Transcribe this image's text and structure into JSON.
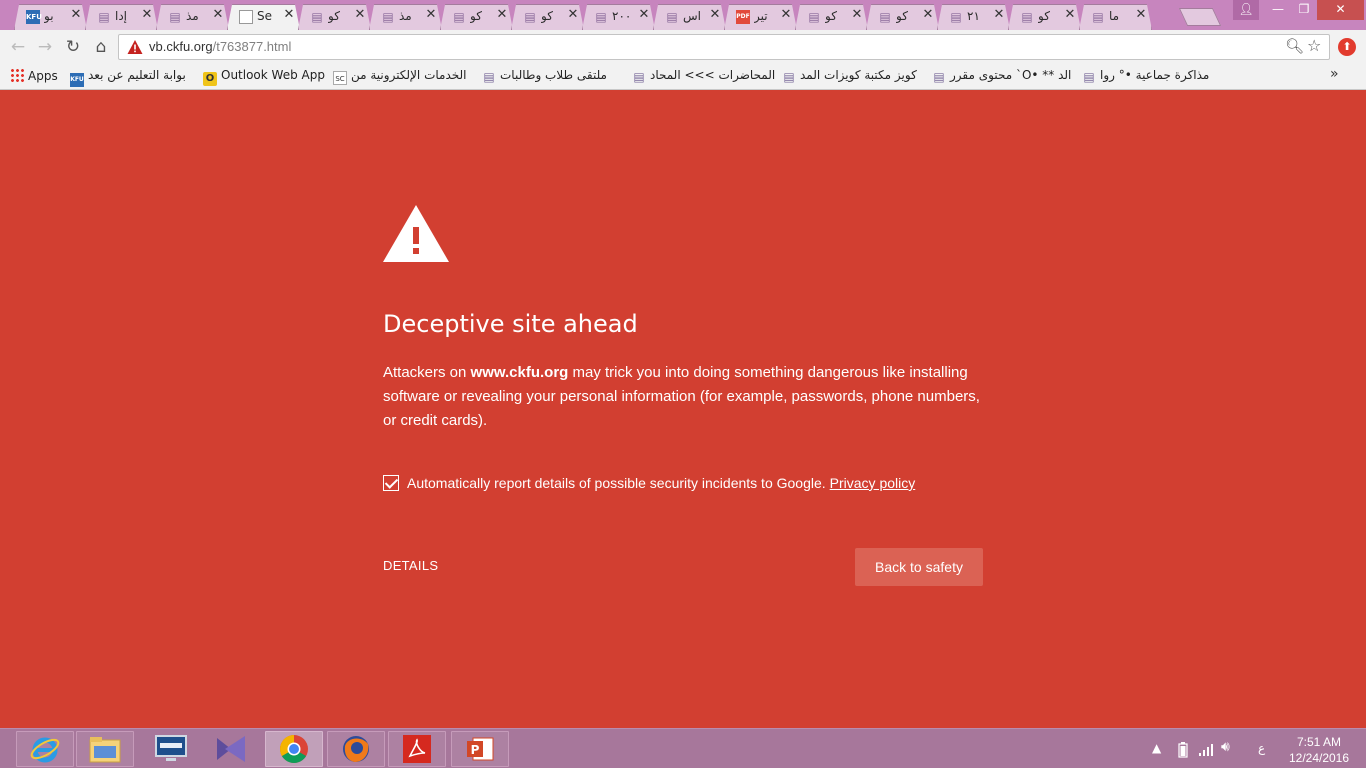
{
  "tabs": [
    {
      "title": "بو",
      "favicon": "kfu-icon"
    },
    {
      "title": "إدا",
      "favicon": "page-icon"
    },
    {
      "title": "مذ",
      "favicon": "page-icon"
    },
    {
      "title": "Se",
      "favicon": "document-icon",
      "active": true
    },
    {
      "title": "كو",
      "favicon": "page-icon"
    },
    {
      "title": "مذ",
      "favicon": "page-icon"
    },
    {
      "title": "كو",
      "favicon": "page-icon"
    },
    {
      "title": "كو",
      "favicon": "page-icon"
    },
    {
      "title": "٢٠٠",
      "favicon": "page-icon"
    },
    {
      "title": "اس",
      "favicon": "page-icon"
    },
    {
      "title": "تير",
      "favicon": "pdf-icon"
    },
    {
      "title": "كو",
      "favicon": "page-icon"
    },
    {
      "title": "كو",
      "favicon": "page-icon"
    },
    {
      "title": "٢١",
      "favicon": "page-icon"
    },
    {
      "title": "كو",
      "favicon": "page-icon"
    },
    {
      "title": "ما",
      "favicon": "page-icon"
    }
  ],
  "address": {
    "host": "vb.ckfu.org",
    "path": "/t763877.html"
  },
  "bookmarks": [
    {
      "label": "Apps"
    },
    {
      "label": "بوابة التعليم عن بعد"
    },
    {
      "label": "Outlook Web App"
    },
    {
      "label": "الخدمات الإلكترونية من"
    },
    {
      "label": "ملتقى طلاب وطالبات"
    },
    {
      "label": "المحاضرات >>> المحاد"
    },
    {
      "label": "كويز مكتبة كويزات المد"
    },
    {
      "label": "محتوى مقرر `O• ** الد"
    },
    {
      "label": "مذاكرة جماعية •° روا"
    }
  ],
  "interstitial": {
    "heading": "Deceptive site ahead",
    "body_prefix": "Attackers on ",
    "body_domain": "www.ckfu.org",
    "body_suffix": " may trick you into doing something dangerous like installing software or revealing your personal information (for example, passwords, phone numbers, or credit cards).",
    "report_label": "Automatically report details of possible security incidents to Google.",
    "report_checked": true,
    "privacy_link": "Privacy policy",
    "details_label": "DETAILS",
    "back_label": "Back to safety"
  },
  "taskbar": {
    "apps": [
      "internet-explorer",
      "file-explorer",
      "lenovo-monitor",
      "visual-studio",
      "chrome",
      "firefox",
      "adobe-acrobat",
      "powerpoint"
    ],
    "language": "ع",
    "time": "7:51 AM",
    "date": "12/24/2016"
  },
  "colors": {
    "page_background": "#d23f31",
    "button_background": "#db6254",
    "title_bar": "#c785be",
    "taskbar": "#a7779b"
  }
}
